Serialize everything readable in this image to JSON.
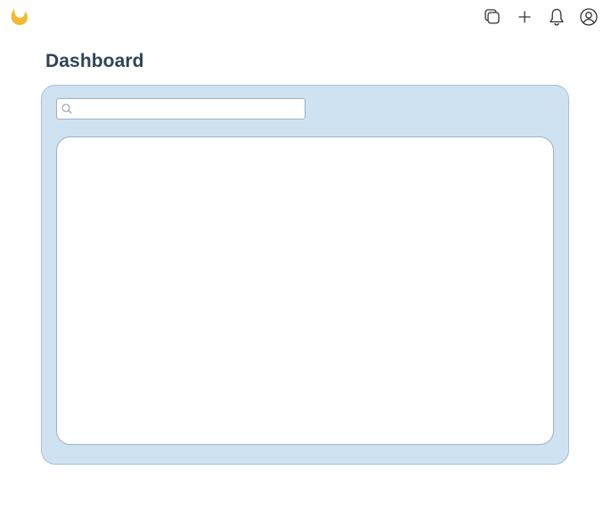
{
  "app": {
    "logo_icon": "flame-icon",
    "brand_color": "#f5b82e"
  },
  "top_actions": [
    {
      "icon": "copy-icon"
    },
    {
      "icon": "plus-icon"
    },
    {
      "icon": "bell-icon"
    },
    {
      "icon": "user-circle-icon"
    }
  ],
  "page": {
    "title": "Dashboard"
  },
  "dashboard": {
    "panel_background": "#cfe2f1",
    "search": {
      "value": "",
      "placeholder": "",
      "icon": "search-icon"
    }
  }
}
